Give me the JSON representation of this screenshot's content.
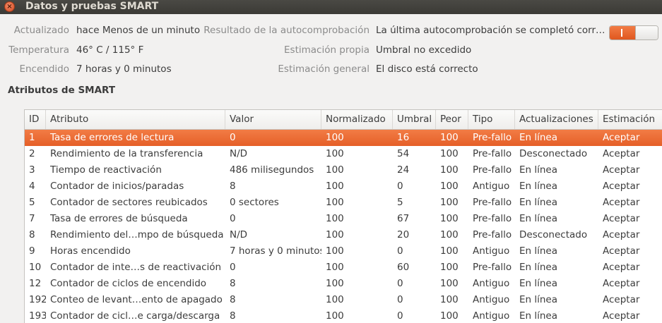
{
  "window": {
    "title": "Datos y pruebas SMART",
    "close_glyph": "×"
  },
  "info": {
    "updated_label": "Actualizado",
    "updated_value": "hace Menos de un minuto",
    "selftest_label": "Resultado de la autocomprobación",
    "selftest_value": "La última autocomprobación se completó corr…",
    "temp_label": "Temperatura",
    "temp_value": "46° C / 115° F",
    "own_label": "Estimación propia",
    "own_value": "Umbral no excedido",
    "poweron_label": "Encendido",
    "poweron_value": "7 horas y 0 minutos",
    "overall_label": "Estimación general",
    "overall_value": "El disco está correcto",
    "toggle_state": "on"
  },
  "section_title": "Atributos de SMART",
  "table": {
    "headers": [
      "ID",
      "Atributo",
      "Valor",
      "Normalizado",
      "Umbral",
      "Peor",
      "Tipo",
      "Actualizaciones",
      "Estimación"
    ],
    "rows": [
      [
        "1",
        "Tasa de errores de lectura",
        "0",
        "100",
        "16",
        "100",
        "Pre-fallo",
        "En línea",
        "Aceptar"
      ],
      [
        "2",
        "Rendimiento de la transferencia",
        "N/D",
        "100",
        "54",
        "100",
        "Pre-fallo",
        "Desconectado",
        "Aceptar"
      ],
      [
        "3",
        "Tiempo de reactivación",
        "486 milisegundos",
        "100",
        "24",
        "100",
        "Pre-fallo",
        "En línea",
        "Aceptar"
      ],
      [
        "4",
        "Contador de inicios/paradas",
        "8",
        "100",
        "0",
        "100",
        "Antiguo",
        "En línea",
        "Aceptar"
      ],
      [
        "5",
        "Contador de sectores reubicados",
        "0 sectores",
        "100",
        "5",
        "100",
        "Pre-fallo",
        "En línea",
        "Aceptar"
      ],
      [
        "7",
        "Tasa de errores de búsqueda",
        "0",
        "100",
        "67",
        "100",
        "Pre-fallo",
        "En línea",
        "Aceptar"
      ],
      [
        "8",
        "Rendimiento del…mpo de búsqueda",
        "N/D",
        "100",
        "20",
        "100",
        "Pre-fallo",
        "Desconectado",
        "Aceptar"
      ],
      [
        "9",
        "Horas encendido",
        "7 horas y 0 minutos",
        "100",
        "0",
        "100",
        "Antiguo",
        "En línea",
        "Aceptar"
      ],
      [
        "10",
        "Contador de inte…s de reactivación",
        "0",
        "100",
        "60",
        "100",
        "Pre-fallo",
        "En línea",
        "Aceptar"
      ],
      [
        "12",
        "Contador de ciclos de encendido",
        "8",
        "100",
        "0",
        "100",
        "Antiguo",
        "En línea",
        "Aceptar"
      ],
      [
        "192",
        "Conteo de levant…ento de apagado",
        "8",
        "100",
        "0",
        "100",
        "Antiguo",
        "En línea",
        "Aceptar"
      ],
      [
        "193",
        "Contador de cicl…e carga/descarga",
        "8",
        "100",
        "0",
        "100",
        "Antiguo",
        "En línea",
        "Aceptar"
      ]
    ],
    "selected_row": 0
  },
  "colors": {
    "accent": "#e8622b",
    "titlebar": "#3c3b37"
  }
}
